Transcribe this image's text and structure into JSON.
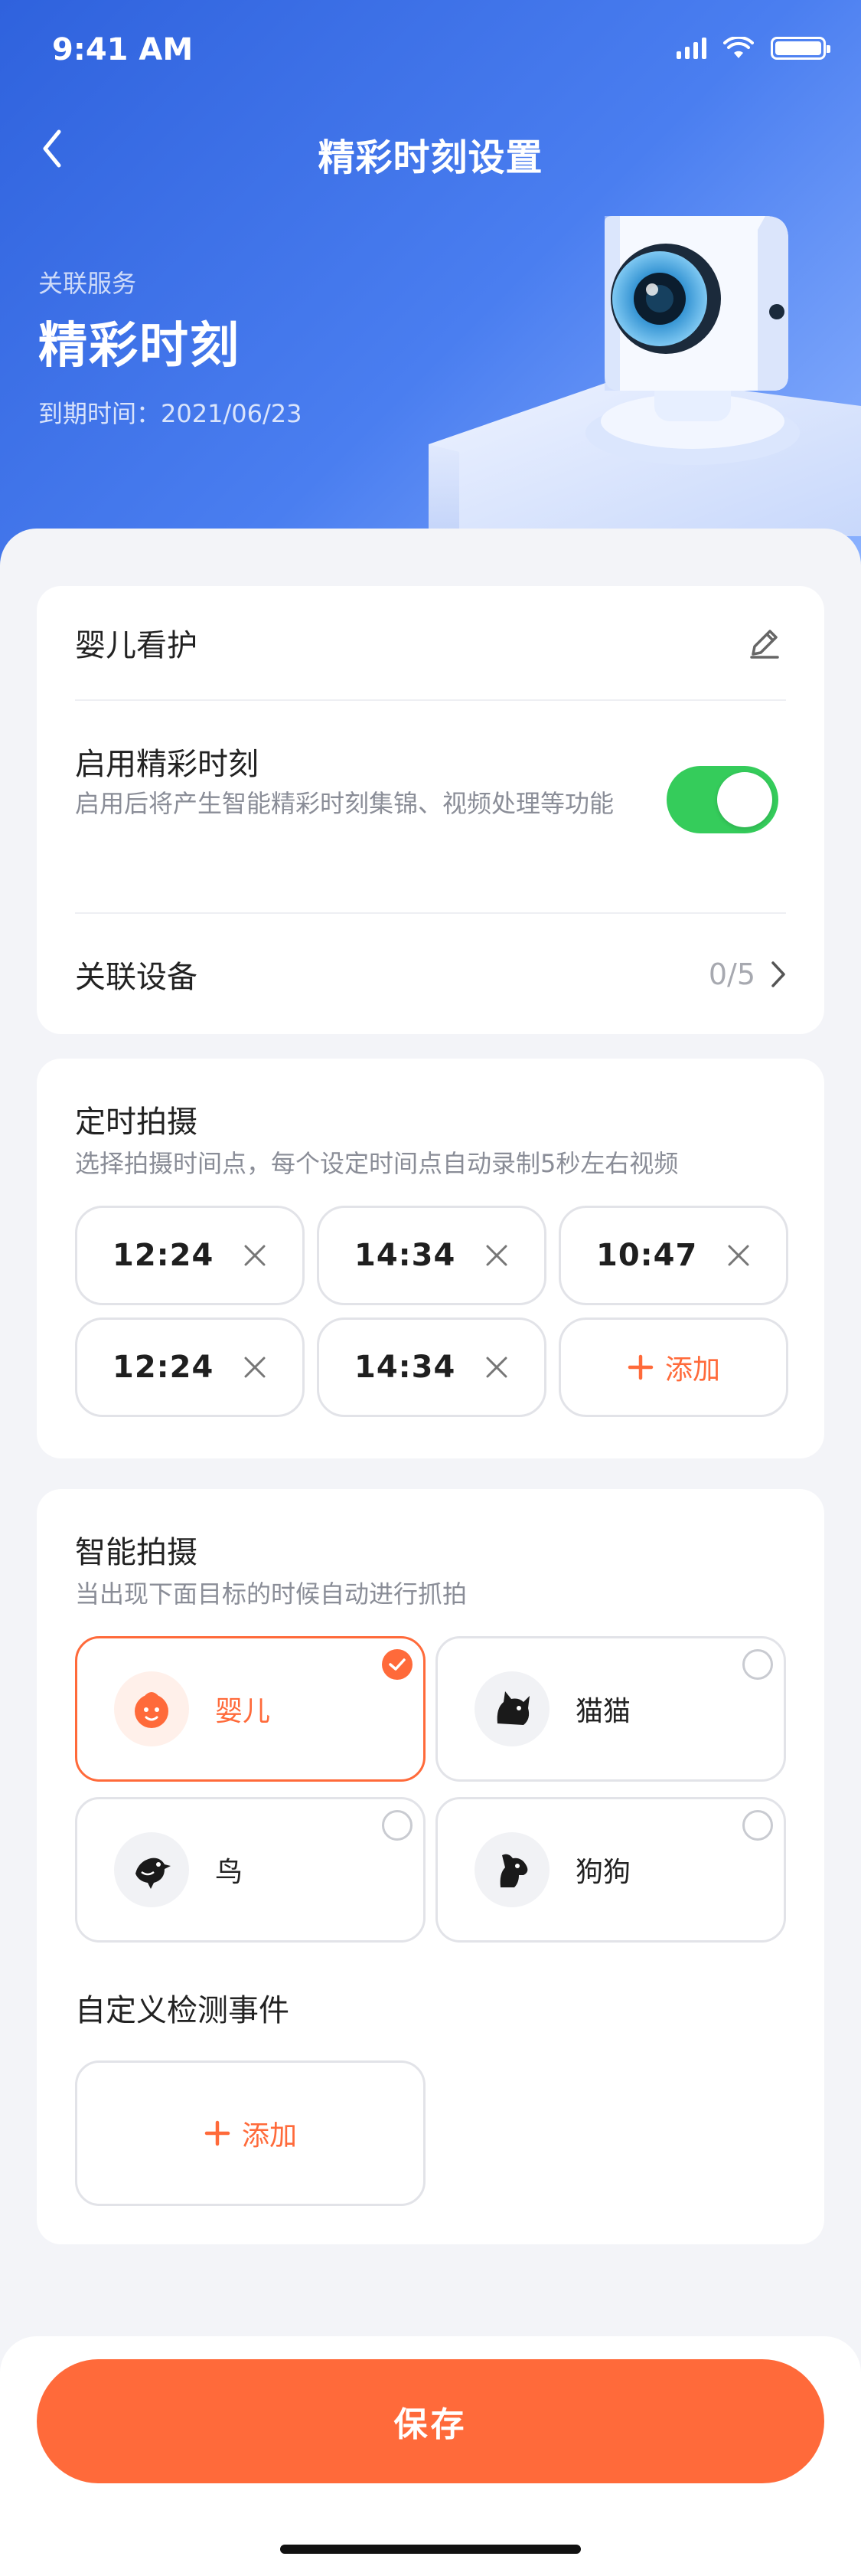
{
  "status_bar": {
    "time": "9:41 AM"
  },
  "nav": {
    "title": "精彩时刻设置"
  },
  "hero": {
    "label": "关联服务",
    "title": "精彩时刻",
    "expire": "到期时间：2021/06/23"
  },
  "colors": {
    "accent": "#ff6a3a",
    "toggle_on": "#35cc5b",
    "header": "#3a6fe8"
  },
  "settings": {
    "name": "婴儿看护",
    "enable_title": "启用精彩时刻",
    "enable_desc": "启用后将产生智能精彩时刻集锦、视频处理等功能",
    "enable_on": true,
    "device_label": "关联设备",
    "device_count": "0/5"
  },
  "schedule": {
    "title": "定时拍摄",
    "desc": "选择拍摄时间点，每个设定时间点自动录制5秒左右视频",
    "times": [
      "12:24",
      "14:34",
      "10:47",
      "12:24",
      "14:34"
    ],
    "add_label": "添加"
  },
  "smart": {
    "title": "智能拍摄",
    "desc": "当出现下面目标的时候自动进行抓拍",
    "targets": [
      {
        "label": "婴儿",
        "icon": "baby-icon",
        "selected": true
      },
      {
        "label": "猫猫",
        "icon": "cat-icon",
        "selected": false
      },
      {
        "label": "鸟",
        "icon": "bird-icon",
        "selected": false
      },
      {
        "label": "狗狗",
        "icon": "dog-icon",
        "selected": false
      }
    ],
    "custom_title": "自定义检测事件",
    "custom_add_label": "添加"
  },
  "footer": {
    "save_label": "保存"
  }
}
